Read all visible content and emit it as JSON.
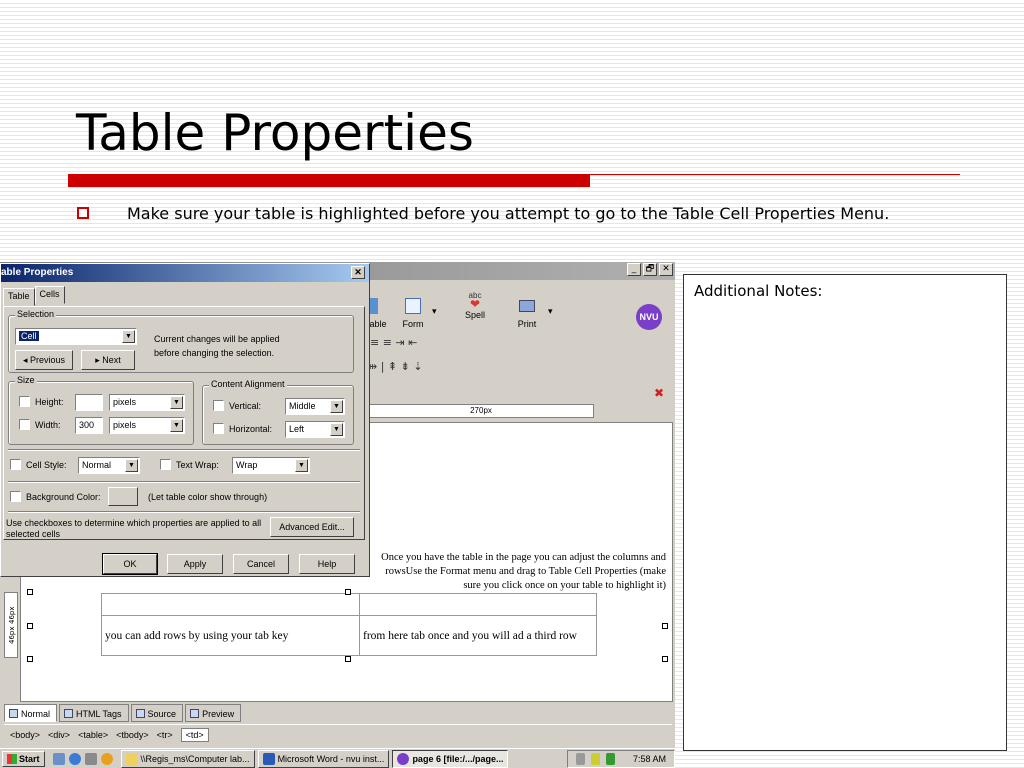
{
  "slide": {
    "title": "Table Properties",
    "bullet": "Make sure your table is highlighted before you attempt to go to the Table Cell Properties Menu.",
    "notes_label": "Additional Notes:",
    "accent_color": "#cc0000"
  },
  "dialog": {
    "title": "able Properties",
    "close": "✕",
    "tabs": [
      "Table",
      "Cells"
    ],
    "selection_group": "Selection",
    "selection_value": "Cell",
    "selection_note_1": "Current changes will be applied",
    "selection_note_2": "before changing the selection.",
    "previous_label": "Previous",
    "next_label": "Next",
    "size_group": "Size",
    "height_label": "Height:",
    "height_value": "",
    "height_unit": "pixels",
    "width_label": "Width:",
    "width_value": "300",
    "width_unit": "pixels",
    "align_group": "Content Alignment",
    "vertical_label": "Vertical:",
    "vertical_value": "Middle",
    "horizontal_label": "Horizontal:",
    "horizontal_value": "Left",
    "cell_style_label": "Cell Style:",
    "cell_style_value": "Normal",
    "text_wrap_label": "Text Wrap:",
    "text_wrap_value": "Wrap",
    "bg_color_label": "Background Color:",
    "bg_color_note": "(Let table color show through)",
    "hint": "Use checkboxes to determine which properties are applied to all selected cells",
    "advanced_edit": "Advanced Edit...",
    "ok": "OK",
    "apply": "Apply",
    "cancel": "Cancel",
    "help": "Help"
  },
  "app": {
    "window_buttons": [
      "_",
      "🗗",
      "✕"
    ],
    "toolbar": [
      {
        "label": "able",
        "icon": "table-icon"
      },
      {
        "label": "Form",
        "icon": "form-icon"
      },
      {
        "label": "Spell",
        "icon": "spell-check-icon"
      },
      {
        "label": "Print",
        "icon": "print-icon"
      }
    ],
    "nvu_logo": "NVU",
    "format_row_1": "≡ ≡  ⇥ ⇤",
    "format_row_2": "⇹ | ⇞ ⇟ ⇣",
    "ruler_text": "270px",
    "editor_text": "Once you have the table in the page you can adjust the columns and rowsUse the Format menu and drag to Table Cell Properties (make sure you click once on your table to highlight it)",
    "table_rows": [
      [
        "",
        ""
      ],
      [
        "you can add rows by using your tab key",
        "from here tab once and you will ad a third row"
      ]
    ],
    "side_ruler": "46px",
    "mode_tabs": [
      "Normal",
      "HTML Tags",
      "Source",
      "Preview"
    ],
    "tag_path": [
      "<body>",
      "<div>",
      "<table>",
      "<tbody>",
      "<tr>",
      "<td>"
    ],
    "taskbar": {
      "start": "Start",
      "tasks": [
        "\\\\Regis_ms\\Computer lab...",
        "Microsoft Word - nvu inst...",
        "page 6 [file:/.../page..."
      ],
      "clock": "7:58 AM"
    }
  }
}
